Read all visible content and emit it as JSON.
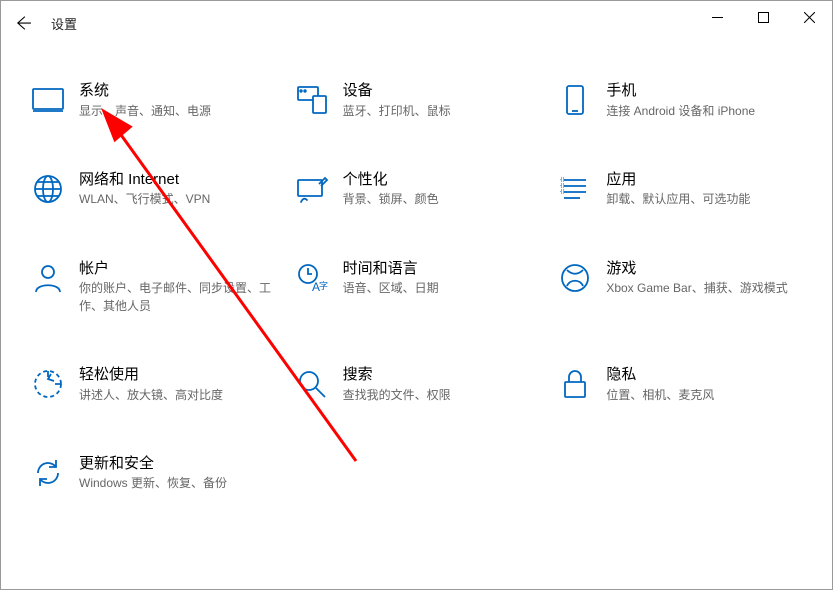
{
  "window": {
    "title": "设置"
  },
  "categories": [
    {
      "key": "system",
      "label": "系统",
      "desc": "显示、声音、通知、电源"
    },
    {
      "key": "devices",
      "label": "设备",
      "desc": "蓝牙、打印机、鼠标"
    },
    {
      "key": "phone",
      "label": "手机",
      "desc": "连接 Android 设备和 iPhone"
    },
    {
      "key": "network",
      "label": "网络和 Internet",
      "desc": "WLAN、飞行模式、VPN"
    },
    {
      "key": "personal",
      "label": "个性化",
      "desc": "背景、锁屏、颜色"
    },
    {
      "key": "apps",
      "label": "应用",
      "desc": "卸载、默认应用、可选功能"
    },
    {
      "key": "accounts",
      "label": "帐户",
      "desc": "你的账户、电子邮件、同步设置、工作、其他人员"
    },
    {
      "key": "time",
      "label": "时间和语言",
      "desc": "语音、区域、日期"
    },
    {
      "key": "gaming",
      "label": "游戏",
      "desc": "Xbox Game Bar、捕获、游戏模式"
    },
    {
      "key": "ease",
      "label": "轻松使用",
      "desc": "讲述人、放大镜、高对比度"
    },
    {
      "key": "search",
      "label": "搜索",
      "desc": "查找我的文件、权限"
    },
    {
      "key": "privacy",
      "label": "隐私",
      "desc": "位置、相机、麦克风"
    },
    {
      "key": "update",
      "label": "更新和安全",
      "desc": "Windows 更新、恢复、备份"
    }
  ]
}
